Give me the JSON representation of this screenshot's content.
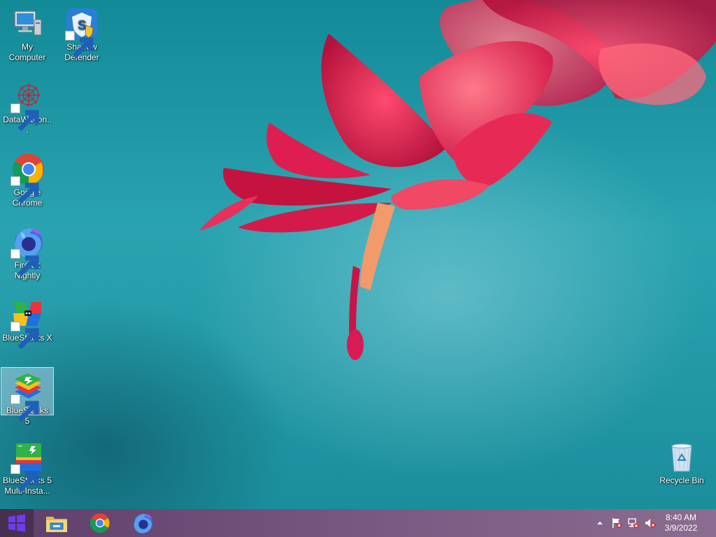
{
  "desktop": {
    "icons": [
      {
        "label": "My Computer",
        "icon": "my-computer-icon",
        "shortcut": false
      },
      {
        "label": "Shadow Defender",
        "icon": "shadow-defender-icon",
        "shortcut": true
      },
      {
        "label": "DataWagon...",
        "icon": "datawagon-icon",
        "shortcut": true
      },
      {
        "label": "Google Chrome",
        "icon": "chrome-icon",
        "shortcut": true
      },
      {
        "label": "Firefox Nightly",
        "icon": "firefox-nightly-icon",
        "shortcut": true
      },
      {
        "label": "BlueStacks X",
        "icon": "bluestacks-x-icon",
        "shortcut": true
      },
      {
        "label": "BlueStacks 5",
        "icon": "bluestacks-5-icon",
        "shortcut": true,
        "selected": true
      },
      {
        "label": "BlueStacks 5 Multi-Insta...",
        "icon": "bluestacks-multi-instance-icon",
        "shortcut": true
      },
      {
        "label": "Recycle Bin",
        "icon": "recycle-bin-icon",
        "shortcut": false
      }
    ]
  },
  "taskbar": {
    "start": {
      "icon": "windows-logo-icon"
    },
    "pinned": [
      {
        "icon": "file-explorer-icon",
        "name": "File Explorer"
      },
      {
        "icon": "chrome-icon",
        "name": "Google Chrome"
      },
      {
        "icon": "firefox-nightly-icon",
        "name": "Firefox Nightly"
      }
    ],
    "tray": {
      "icons": [
        "show-hidden-icons-chevron-icon",
        "action-center-flag-icon",
        "network-disconnected-icon",
        "volume-muted-icon"
      ],
      "time": "8:40 AM",
      "date": "3/9/2022"
    }
  },
  "colors": {
    "wallpaper_teal": "#1b8e9c",
    "flower_red": "#d0184a",
    "taskbar_purple": "#6e4f78",
    "selection": "#c8e1f5"
  }
}
